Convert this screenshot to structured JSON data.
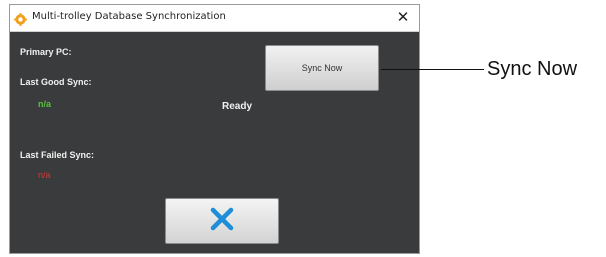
{
  "window": {
    "title": "Multi-trolley Database Synchronization",
    "app_icon": "gear-icon",
    "close_symbol": "✕"
  },
  "panel": {
    "primary_pc_label": "Primary PC:",
    "last_good_sync_label": "Last Good Sync:",
    "last_good_sync_value": "n/a",
    "status_text": "Ready",
    "last_failed_sync_label": "Last Failed Sync:",
    "last_failed_sync_value": "n/a",
    "sync_button_label": "Sync Now",
    "cancel_button_icon": "close-x-icon"
  },
  "annotation": {
    "callout_label": "Sync Now"
  },
  "colors": {
    "background": "#3a3b3c",
    "good_value": "#58c23e",
    "failed_value": "#e0332e",
    "cancel_x": "#1e8ed8"
  }
}
